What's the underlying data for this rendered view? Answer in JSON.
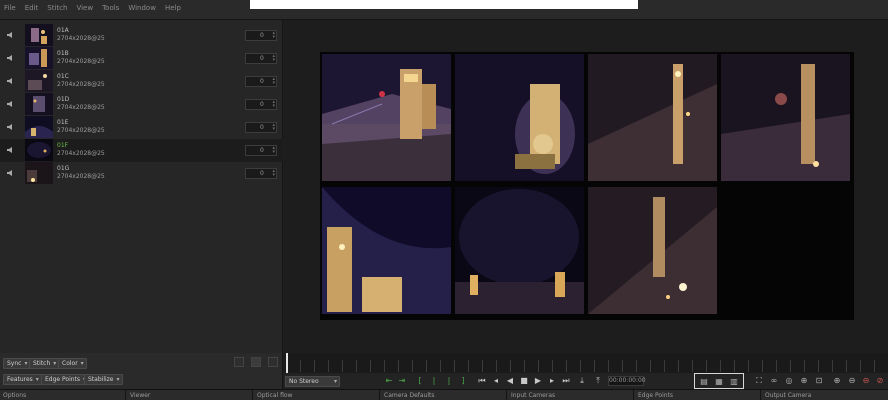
{
  "menu": {
    "items": [
      "File",
      "Edit",
      "Stitch",
      "View",
      "Tools",
      "Window",
      "Help"
    ]
  },
  "cameras": [
    {
      "name": "01A",
      "resolution": "2704x2028@25",
      "offset": "0",
      "selected": false
    },
    {
      "name": "01B",
      "resolution": "2704x2028@25",
      "offset": "0",
      "selected": false
    },
    {
      "name": "01C",
      "resolution": "2704x2028@25",
      "offset": "0",
      "selected": false
    },
    {
      "name": "01D",
      "resolution": "2704x2028@25",
      "offset": "0",
      "selected": false
    },
    {
      "name": "01E",
      "resolution": "2704x2028@25",
      "offset": "0",
      "selected": false
    },
    {
      "name": "01F",
      "resolution": "2704x2028@25",
      "offset": "0",
      "selected": true
    },
    {
      "name": "01G",
      "resolution": "2704x2028@25",
      "offset": "0",
      "selected": false
    }
  ],
  "left_footer": {
    "sync_label": "Sync",
    "stitch_label": "Stitch",
    "color_label": "Color",
    "features_label": "Features",
    "edge_points_label": "Edge Points",
    "stabilize_label": "Stabilize"
  },
  "transport": {
    "stereo_mode": "No Stereo",
    "timecode": "00:00:00:00"
  },
  "bottom_tabs": [
    "Options",
    "Viewer",
    "Optical flow",
    "Camera Defaults",
    "Input Cameras",
    "Edge Points",
    "Output Camera"
  ],
  "accent": {
    "selected_text": "#6fbf4a",
    "green_buttons": "#4aa64a"
  }
}
